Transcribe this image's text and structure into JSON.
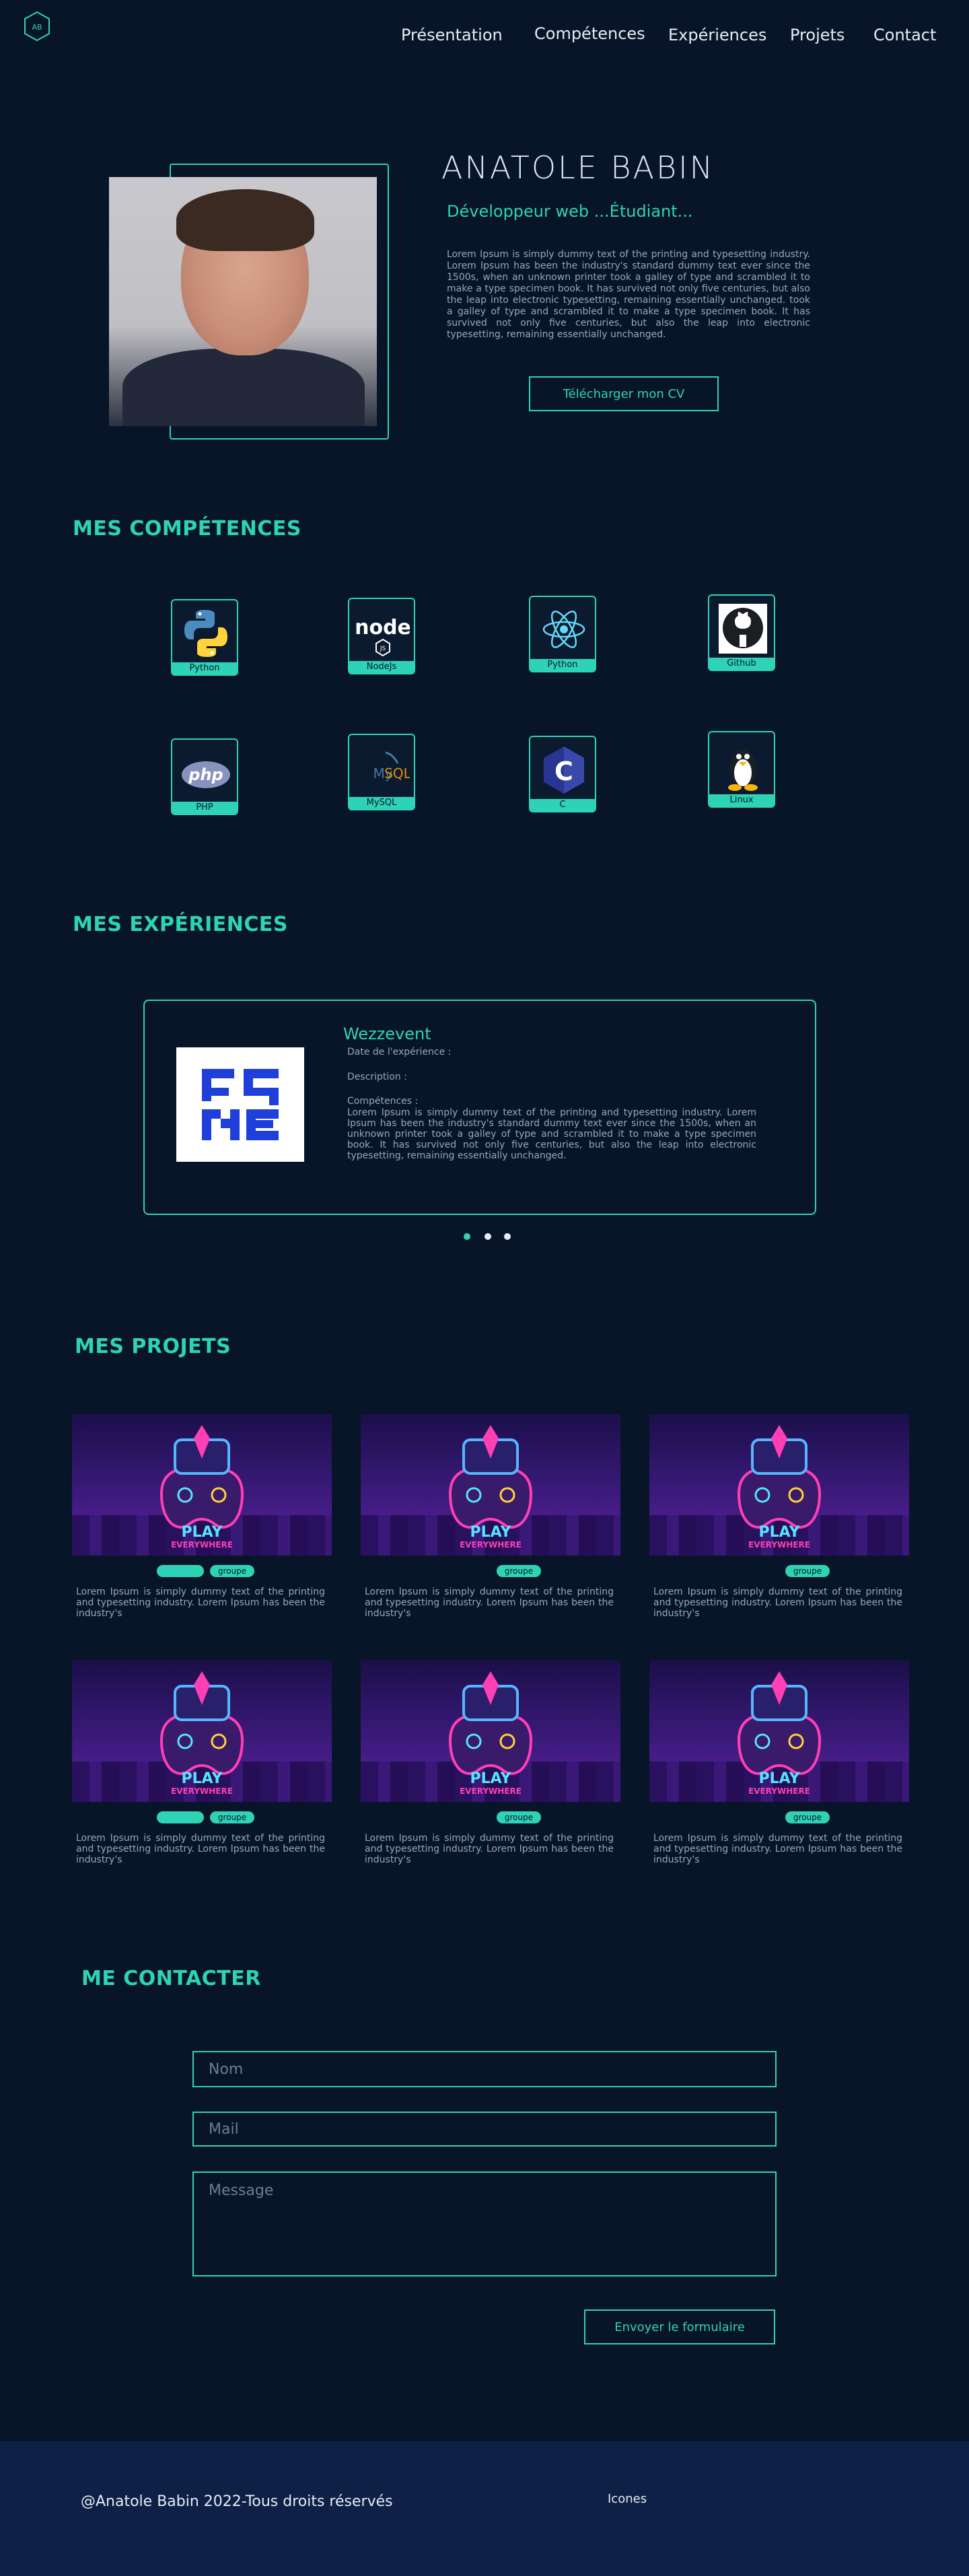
{
  "header": {
    "logo_text": "AB",
    "nav": [
      {
        "label": "Présentation"
      },
      {
        "label": "Compétences"
      },
      {
        "label": "Expériences"
      },
      {
        "label": "Projets"
      },
      {
        "label": "Contact"
      }
    ]
  },
  "hero": {
    "name": "ANATOLE BABIN",
    "role": "Développeur web ...Étudiant...",
    "text": "Lorem Ipsum is simply dummy text of the printing and typesetting industry. Lorem Ipsum has been the industry's standard dummy text ever since the 1500s, when an unknown printer took a galley of type and scrambled it to make a type specimen book. It has survived not only five centuries, but also the leap into electronic typesetting, remaining essentially unchanged. took a galley of type and scrambled it to make a type specimen book. It has survived not only five centuries, but also the leap into electronic typesetting, remaining essentially unchanged.",
    "cv_button": "Télécharger mon CV"
  },
  "skills": {
    "title": "MES COMPÉTENCES",
    "items": [
      {
        "label": "Python",
        "icon": "python-icon"
      },
      {
        "label": "NodeJs",
        "icon": "nodejs-icon"
      },
      {
        "label": "Python",
        "icon": "react-icon"
      },
      {
        "label": "Github",
        "icon": "github-icon"
      },
      {
        "label": "PHP",
        "icon": "php-icon"
      },
      {
        "label": "MySQL",
        "icon": "mysql-icon"
      },
      {
        "label": "C",
        "icon": "c-icon"
      },
      {
        "label": "Linux",
        "icon": "linux-icon"
      }
    ]
  },
  "experiences": {
    "title": "MES EXPÉRIENCES",
    "company": "Wezzevent",
    "date_label": "Date de l'expérience :",
    "description_label": "Description :",
    "skills_label": "Compétences :",
    "skills_text": "Lorem Ipsum is simply dummy text of the printing and typesetting industry. Lorem Ipsum has been the industry's standard dummy text ever since the 1500s, when an unknown printer took a galley of type and scrambled it to make a type specimen book. It has survived not only five centuries, but also the leap into electronic typesetting, remaining essentially unchanged."
  },
  "projects": {
    "title": "MES PROJETS",
    "image_caption_top": "PLAY",
    "image_caption_bottom": "EVERYWHERE",
    "tag": "groupe",
    "text": "Lorem Ipsum is simply dummy text of the printing and typesetting industry. Lorem Ipsum has been the industry's"
  },
  "contact": {
    "title": "ME CONTACTER",
    "name_placeholder": "Nom",
    "mail_placeholder": "Mail",
    "message_placeholder": "Message",
    "submit": "Envoyer le formulaire"
  },
  "footer": {
    "copyright": "@Anatole Babin 2022-Tous droits réservés",
    "icons": "Icones"
  },
  "colors": {
    "background": "#081528",
    "accent": "#2ed3b7",
    "footer": "#0f2046"
  }
}
